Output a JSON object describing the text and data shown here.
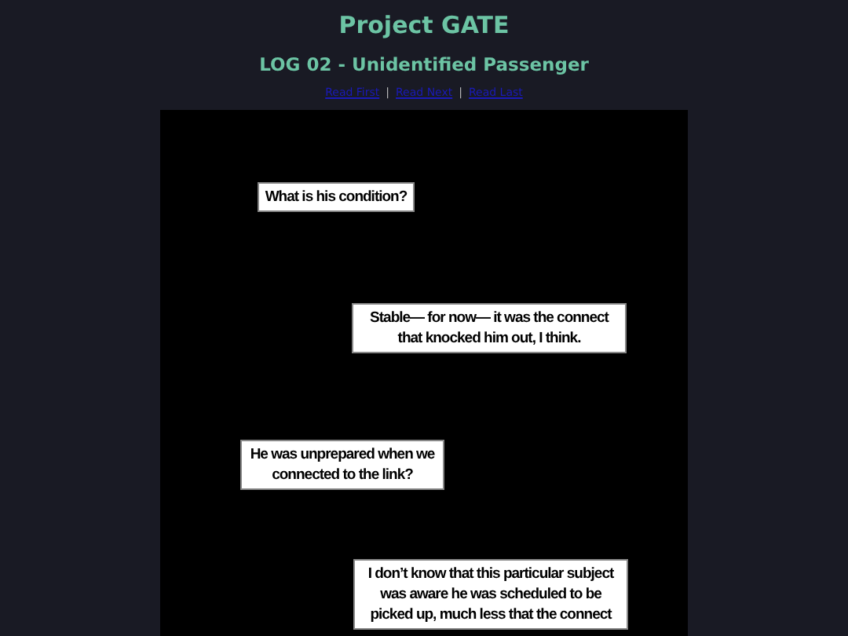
{
  "site_title": "Project GATE",
  "log_title": "LOG 02 - Unidentified Passenger",
  "nav_links": [
    "Read First",
    "Read Next",
    "Read Last"
  ],
  "nav_separator": "|",
  "comic_panel": {
    "captions": [
      {
        "lines": [
          "What is his condition?"
        ]
      },
      {
        "lines": [
          "Stable— for now— it was the connect",
          "that knocked him out, I think."
        ]
      },
      {
        "lines": [
          "He was unprepared when we",
          "connected to the link?"
        ]
      },
      {
        "lines": [
          "I don’t know that this particular subject",
          "was aware he was scheduled to be",
          "picked up, much less that the connect"
        ]
      }
    ]
  }
}
